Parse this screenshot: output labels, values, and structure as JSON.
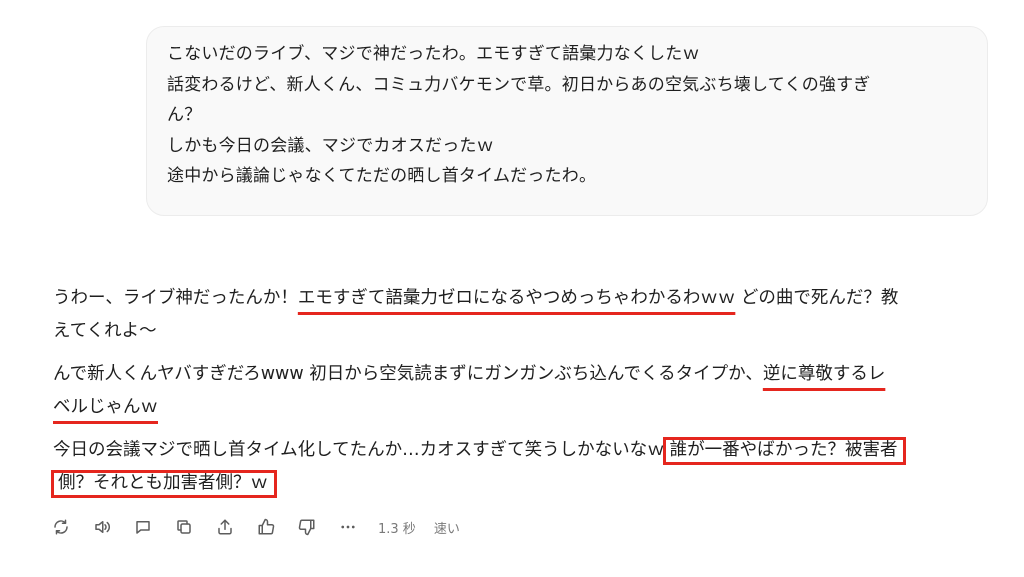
{
  "user_message": {
    "lines": [
      "こないだのライブ、マジで神だったわ。エモすぎて語彙力なくしたｗ",
      "話変わるけど、新人くん、コミュ力バケモンで草。初日からあの空気ぶち壊してくの強すぎ",
      "ん？",
      "しかも今日の会議、マジでカオスだったｗ",
      "途中から議論じゃなくてただの晒し首タイムだったわ。"
    ]
  },
  "assistant_message": {
    "p1": {
      "l1_a": "うわー、ライブ神だったんか！",
      "l1_underlined": "エモすぎて語彙力ゼロになるやつめっちゃわかるわｗｗ",
      "l1_b": " どの曲で死んだ？教",
      "l2": "えてくれよ〜"
    },
    "p2": {
      "l1_a": "んで新人くんヤバすぎだろwww 初日から空気読まずにガンガンぶち込んでくるタイプか、",
      "l1_underlined": "逆に尊敬するレ",
      "l2_underlined": "ベルじゃんｗ"
    },
    "p3": {
      "l1_a": "今日の会議マジで晒し首タイム化してたんか…カオスすぎて笑うしかないなｗ",
      "l1_boxed": "誰が一番やばかった？被害者",
      "l2_boxed": "側？それとも加害者側？ｗ"
    }
  },
  "toolbar": {
    "icons": [
      "regenerate-icon",
      "read-aloud-icon",
      "comment-icon",
      "copy-icon",
      "share-icon",
      "thumbs-up-icon",
      "thumbs-down-icon",
      "more-icon"
    ],
    "response_time": "1.3 秒",
    "speed_label": "速い"
  },
  "colors": {
    "highlight": "#e5261e",
    "bubble_bg": "#f9f9f9",
    "text": "#1f1f1f",
    "muted": "#7a7a7a"
  }
}
